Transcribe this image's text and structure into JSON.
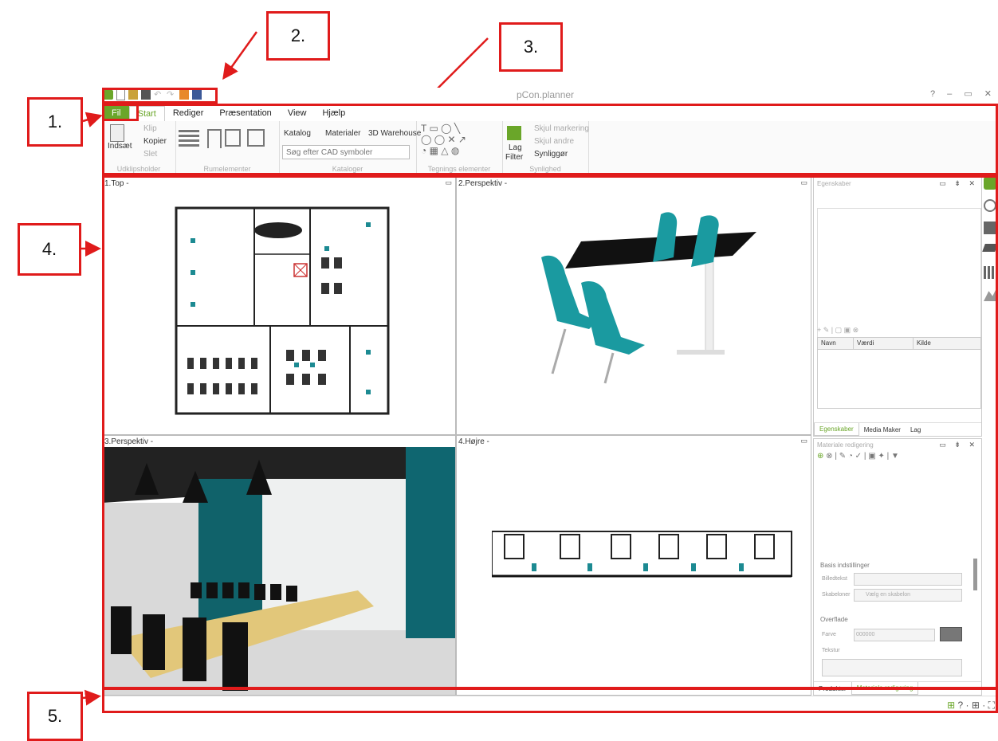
{
  "callouts": {
    "c1": "1.",
    "c2": "2.",
    "c3": "3.",
    "c4": "4.",
    "c5": "5."
  },
  "app": {
    "title": "pCon.planner",
    "window_controls": "? – ▭ ✕"
  },
  "tabs": [
    "Fil",
    "Start",
    "Rediger",
    "Præsentation",
    "View",
    "Hjælp"
  ],
  "ribbon": {
    "clipboard": {
      "paste": "Indsæt",
      "cut": "Klip",
      "copy": "Kopier",
      "delete": "Slet",
      "group": "Udklipsholder"
    },
    "room": {
      "group": "Rumelementer"
    },
    "catalogs": {
      "catalog": "Katalog",
      "materials": "Materialer",
      "warehouse": "3D Warehouse",
      "search_placeholder": "Søg efter CAD symboler",
      "group": "Kataloger"
    },
    "drawing": {
      "group": "Tegnings elementer"
    },
    "visibility": {
      "layer": "Lag",
      "filter": "Filter",
      "hide_selection": "Skjul markering",
      "hide_others": "Skjul andre",
      "visibility": "Synliggør",
      "group": "Synlighed"
    }
  },
  "viewports": [
    {
      "label": "1.Top -"
    },
    {
      "label": "2.Perspektiv -"
    },
    {
      "label": "3.Perspektiv -"
    },
    {
      "label": "4.Højre -"
    }
  ],
  "properties_panel": {
    "title": "Egenskaber",
    "columns": [
      "Navn",
      "Værdi",
      "Kilde"
    ],
    "tabs": [
      "Egenskaber",
      "Media Maker",
      "Lag"
    ]
  },
  "material_panel": {
    "title": "Materiale redigering",
    "basis": "Basis indstillinger",
    "image_text": "Billedtekst",
    "templates": "Skabeloner",
    "template_placeholder": "Vælg en skabelon",
    "surface": "Overflade",
    "color": "Farve",
    "color_value": "000000",
    "texture": "Tekstur",
    "tabs": [
      "Produkter",
      "Materiale redigering"
    ]
  },
  "colors": {
    "accent": "#6aa629",
    "callout": "#e01b1b",
    "teal": "#1c8a92"
  }
}
